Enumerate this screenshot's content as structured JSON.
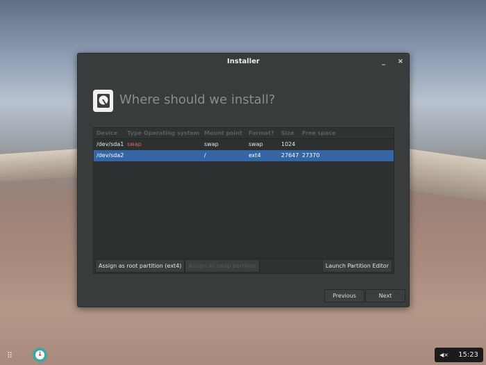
{
  "window": {
    "title": "Installer",
    "minimize": "_",
    "close": "×"
  },
  "heading": "Where should we install?",
  "table": {
    "headers": [
      "Device",
      "Type",
      "Operating system",
      "Mount point",
      "Format?",
      "Size",
      "Free space"
    ],
    "rows": [
      [
        "/dev/sda1",
        "swap",
        "",
        "swap",
        "swap",
        "1024",
        ""
      ],
      [
        "/dev/sda2",
        "",
        "",
        "/",
        "ext4",
        "27647",
        "27370"
      ]
    ],
    "selected_row": 1,
    "swap_type_color": "#d36b5e"
  },
  "buttons": {
    "assign_root": "Assign as root partition (ext4)",
    "assign_swap": "Assign as swap partition",
    "launch_editor": "Launch Partition Editor",
    "previous": "Previous",
    "next": "Next"
  },
  "taskbar": {
    "apps_icon": "⠿",
    "clock": "15:23",
    "volume_icon": "◀×"
  }
}
